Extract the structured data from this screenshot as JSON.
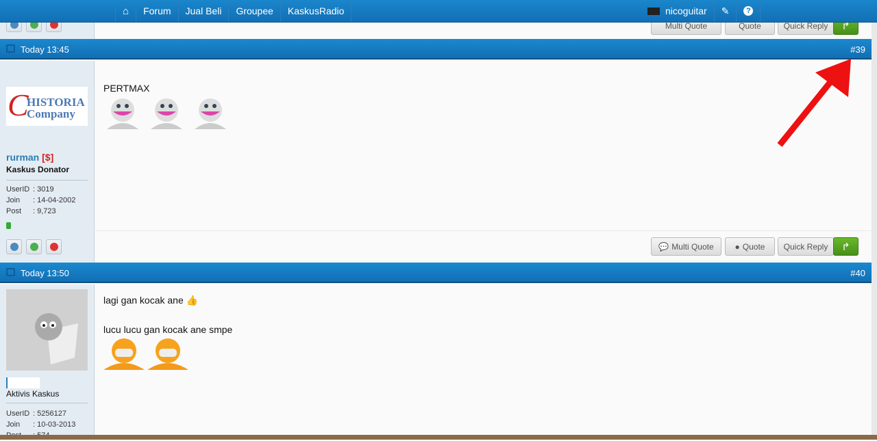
{
  "nav": {
    "home_icon": "home-icon",
    "items": [
      "Forum",
      "Jual Beli",
      "Groupee",
      "KaskusRadio"
    ],
    "username": "nicoguitar",
    "edit_icon": "pencil-icon",
    "help_icon": "question-icon"
  },
  "buttons": {
    "multi_quote": "Multi Quote",
    "quote": "Quote",
    "quick_reply": "Quick Reply"
  },
  "posts": [
    {
      "date": "Today 13:45",
      "number": "#39",
      "user": {
        "name": "rurman",
        "badge": "[$]",
        "rank": "Kaskus Donator",
        "avatar_text": "HISTORIA Company",
        "userid_label": "UserID",
        "userid": ": 3019",
        "join_label": "Join",
        "join": ": 14-04-2002",
        "post_label": "Post",
        "post": ": 9,723"
      },
      "content": [
        "PERTMAX"
      ]
    },
    {
      "date": "Today 13:50",
      "number": "#40",
      "user": {
        "name": "",
        "rank": "Aktivis Kaskus",
        "userid_label": "UserID",
        "userid": ": 5256127",
        "join_label": "Join",
        "join": ": 10-03-2013",
        "post_label": "Post",
        "post": ": 574"
      },
      "content": [
        "lagi gan kocak ane",
        "lucu lucu gan kocak ane smpe"
      ]
    }
  ],
  "colors": {
    "nav": "#1479bf",
    "green": "#52a01f",
    "annotation_arrow": "#ee1111"
  }
}
